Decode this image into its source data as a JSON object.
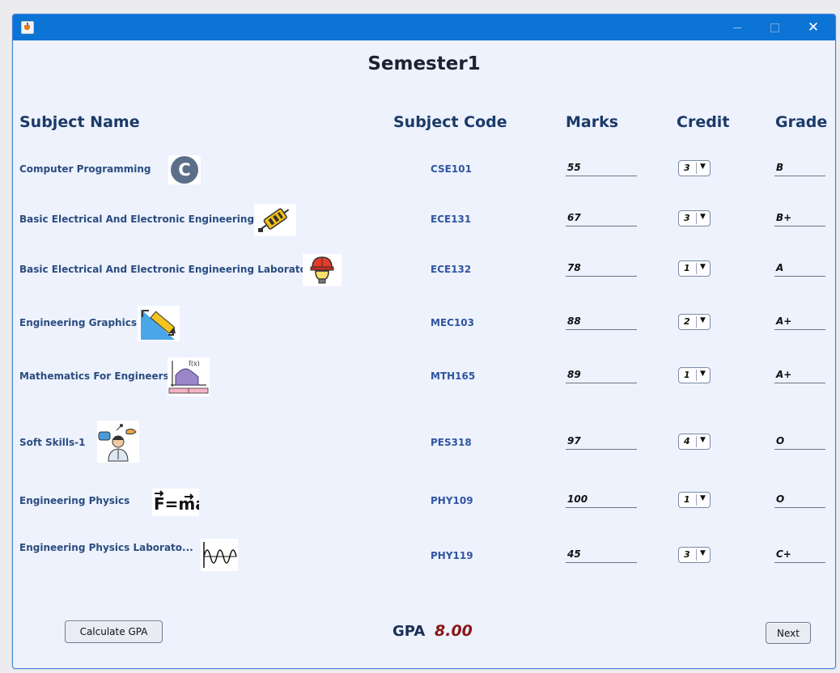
{
  "window": {
    "title_icon": "java-cup-icon",
    "controls": {
      "minimize": "—",
      "maximize": "☐",
      "close": "✕"
    }
  },
  "title": "Semester1",
  "headers": {
    "subject_name": "Subject Name",
    "subject_code": "Subject Code",
    "marks": "Marks",
    "credit": "Credit",
    "grade": "Grade"
  },
  "subjects": [
    {
      "name": "Computer Programming",
      "icon": "c-language-icon",
      "code": "CSE101",
      "marks": "55",
      "credit": "3",
      "grade": "B"
    },
    {
      "name": "Basic Electrical And Electronic Engineering",
      "icon": "electronic-component-icon",
      "code": "ECE131",
      "marks": "67",
      "credit": "3",
      "grade": "B+"
    },
    {
      "name": "Basic Electrical And Electronic Engineering Laborator..",
      "icon": "engineer-bulb-icon",
      "code": "ECE132",
      "marks": "78",
      "credit": "1",
      "grade": "A"
    },
    {
      "name": "Engineering Graphics",
      "icon": "design-pen-icon",
      "code": "MEC103",
      "marks": "88",
      "credit": "2",
      "grade": "A+"
    },
    {
      "name": "Mathematics For Engineers",
      "icon": "function-graph-icon",
      "code": "MTH165",
      "marks": "89",
      "credit": "1",
      "grade": "A+"
    },
    {
      "name": "Soft Skills-1",
      "icon": "communication-person-icon",
      "code": "PES318",
      "marks": "97",
      "credit": "4",
      "grade": "O"
    },
    {
      "name": "Engineering Physics",
      "icon": "force-formula-icon",
      "code": "PHY109",
      "marks": "100",
      "credit": "1",
      "grade": "O"
    },
    {
      "name": "Engineering Physics Laborato...",
      "icon": "waveform-icon",
      "code": "PHY119",
      "marks": "45",
      "credit": "3",
      "grade": "C+"
    }
  ],
  "footer": {
    "calculate_button": "Calculate GPA",
    "gpa_label": "GPA",
    "gpa_value": "8.00",
    "next_button": "Next"
  }
}
